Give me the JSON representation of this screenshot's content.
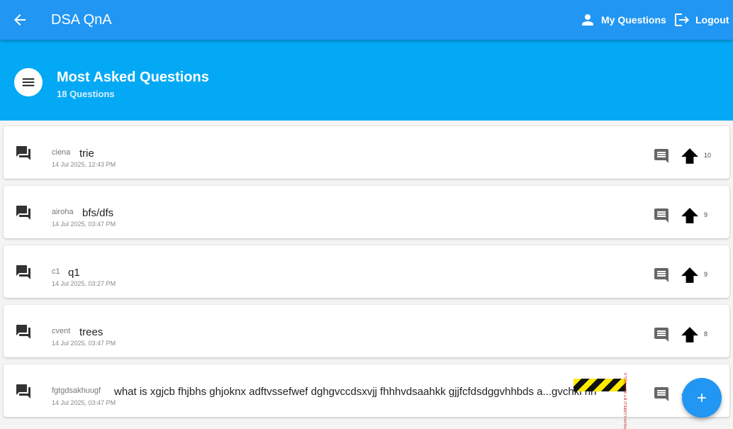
{
  "appbar": {
    "title": "DSA QnA",
    "back_icon": "arrow-back-icon",
    "my_questions_label": "My Questions",
    "my_questions_icon": "person-icon",
    "logout_label": "Logout",
    "logout_icon": "logout-icon"
  },
  "header": {
    "title": "Most Asked Questions",
    "subtitle": "18 Questions",
    "menu_icon": "menu-icon"
  },
  "questions": [
    {
      "company": "ciena",
      "title": "trie",
      "date": "14 Jul 2025, 12:43 PM",
      "votes": "10"
    },
    {
      "company": "airoha",
      "title": "bfs/dfs",
      "date": "14 Jul 2025, 03:47 PM",
      "votes": "9"
    },
    {
      "company": "c1",
      "title": "q1",
      "date": "14 Jul 2025, 03:27 PM",
      "votes": "9"
    },
    {
      "company": "cvent",
      "title": "trees",
      "date": "14 Jul 2025, 03:47 PM",
      "votes": "8"
    },
    {
      "company": "fgtgdsakhuugf",
      "title": "what is xgjcb fhjbhs ghjoknx adftvssefwef dghgvccdsxvjj fhhhvdsaahkk gjjfcfdsdggvhhbds a...gvchkl hh",
      "date": "14 Jul 2025, 03:47 PM",
      "votes": ""
    }
  ],
  "overflow_warning": "RIGHT OVERFLOWED BY 65 PIXELS",
  "fab_icon": "add-icon",
  "colors": {
    "appbar": "#2196f3",
    "header": "#03a9f4",
    "fab": "#2196f3"
  }
}
